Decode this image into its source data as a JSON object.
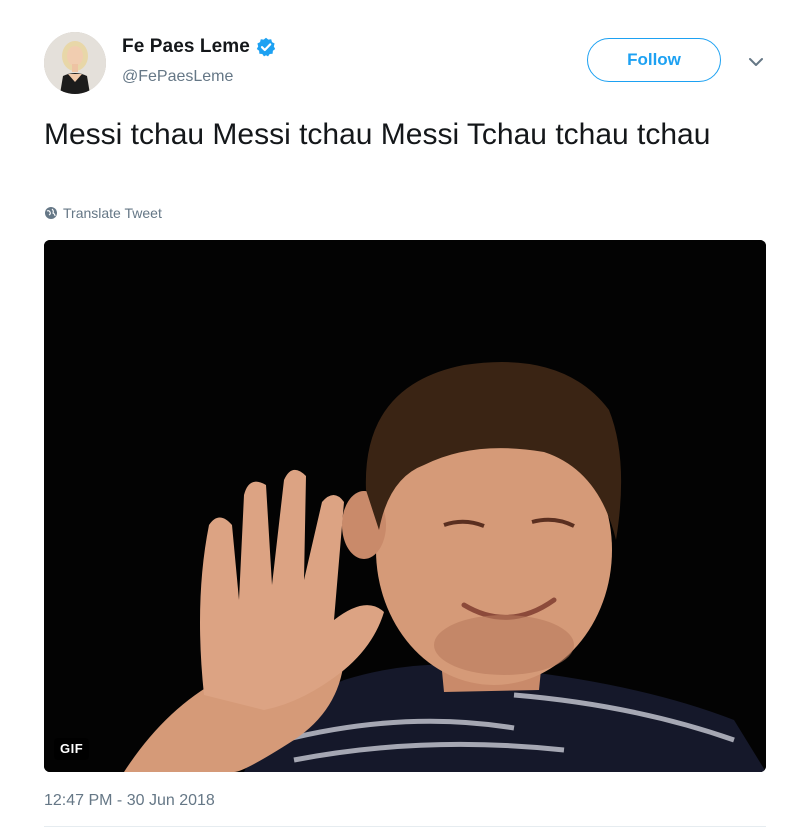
{
  "user": {
    "display_name": "Fe Paes Leme",
    "handle": "@FePaesLeme",
    "verified": true,
    "avatar_icon": "profile-photo"
  },
  "actions": {
    "follow_label": "Follow",
    "menu_icon": "chevron-down-icon"
  },
  "tweet": {
    "text": "Messi tchau Messi tchau Messi Tchau tchau tchau",
    "translate_label": "Translate Tweet",
    "media_badge": "GIF",
    "timestamp": "12:47 PM - 30 Jun 2018"
  },
  "colors": {
    "accent": "#1da1f2",
    "text_primary": "#14171a",
    "text_secondary": "#657786"
  }
}
